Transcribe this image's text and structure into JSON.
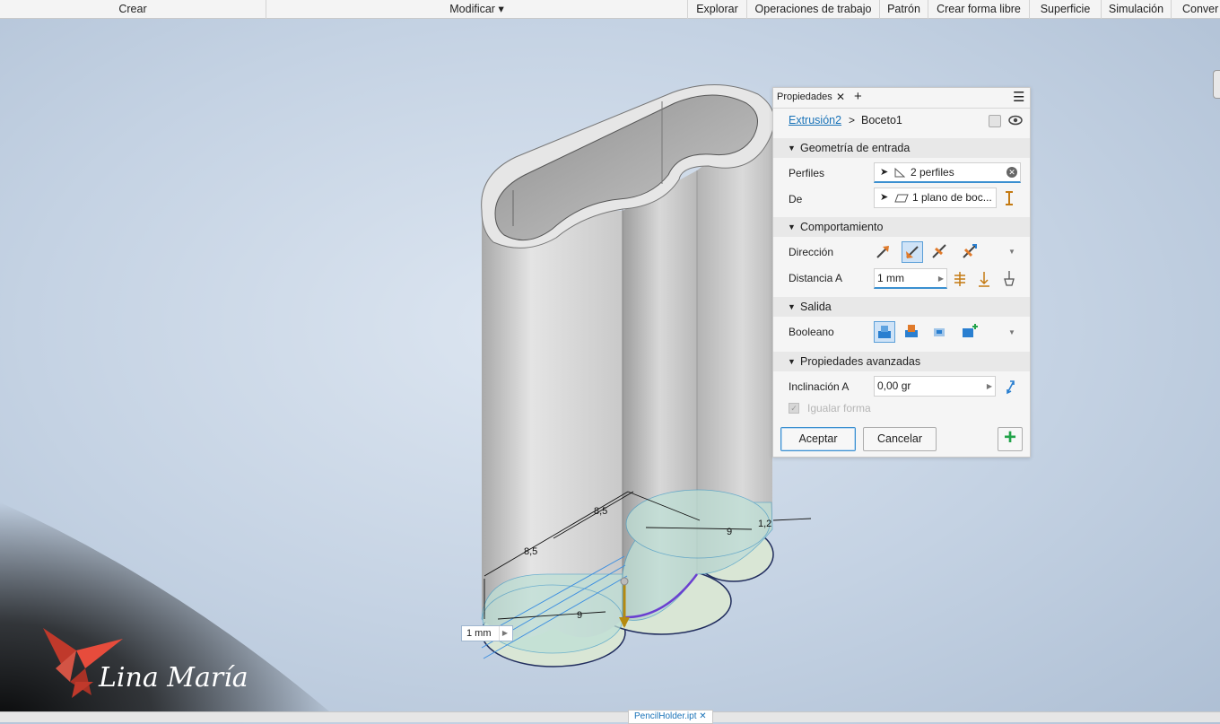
{
  "menu": {
    "items": [
      {
        "label": "Crear"
      },
      {
        "label": "Modificar ▾"
      },
      {
        "label": "Explorar"
      },
      {
        "label": "Operaciones de trabajo"
      },
      {
        "label": "Patrón"
      },
      {
        "label": "Crear forma libre"
      },
      {
        "label": "Superficie"
      },
      {
        "label": "Simulación"
      },
      {
        "label": "Conver"
      }
    ]
  },
  "panel": {
    "tab_label": "Propiedades",
    "close_glyph": "✕",
    "add_glyph": "+",
    "menu_glyph": "☰",
    "breadcrumb": {
      "feature": "Extrusión2",
      "separator": ">",
      "sketch": "Boceto1"
    },
    "sections": {
      "geometry": "Geometría de entrada",
      "behavior": "Comportamiento",
      "output": "Salida",
      "advanced": "Propiedades avanzadas"
    },
    "fields": {
      "profiles_label": "Perfiles",
      "profiles_value": "2 perfiles",
      "from_label": "De",
      "from_value": "1 plano de boc...",
      "direction_label": "Dirección",
      "distance_label": "Distancia A",
      "distance_value": "1 mm",
      "boolean_label": "Booleano",
      "taper_label": "Inclinación A",
      "taper_value": "0,00 gr",
      "match_shape_label": "Igualar forma"
    },
    "buttons": {
      "ok": "Aceptar",
      "cancel": "Cancelar",
      "add": "+"
    }
  },
  "viewport": {
    "dimensions": {
      "d1": "8,5",
      "d2": "8,5",
      "d3": "9",
      "d4": "9",
      "d5": "1,2"
    },
    "distance_input": "1 mm"
  },
  "watermark": {
    "text": "Lina María"
  },
  "bottom_tab": {
    "label": "PencilHolder.ipt"
  },
  "colors": {
    "accent": "#3a8fd0",
    "selected_bg": "#cfe3f7",
    "sketch_fill": "#bfe0d6",
    "profile_edge": "#6a3fd0",
    "add_green": "#22a34a"
  }
}
